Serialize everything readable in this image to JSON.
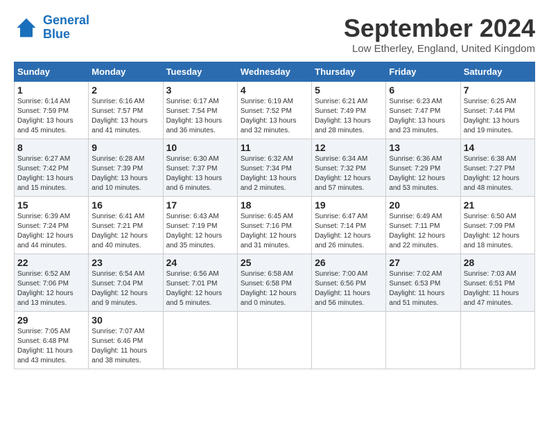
{
  "logo": {
    "line1": "General",
    "line2": "Blue"
  },
  "title": "September 2024",
  "subtitle": "Low Etherley, England, United Kingdom",
  "days_of_week": [
    "Sunday",
    "Monday",
    "Tuesday",
    "Wednesday",
    "Thursday",
    "Friday",
    "Saturday"
  ],
  "weeks": [
    [
      {
        "day": 1,
        "sunrise": "6:14 AM",
        "sunset": "7:59 PM",
        "daylight": "13 hours and 45 minutes"
      },
      {
        "day": 2,
        "sunrise": "6:16 AM",
        "sunset": "7:57 PM",
        "daylight": "13 hours and 41 minutes"
      },
      {
        "day": 3,
        "sunrise": "6:17 AM",
        "sunset": "7:54 PM",
        "daylight": "13 hours and 36 minutes"
      },
      {
        "day": 4,
        "sunrise": "6:19 AM",
        "sunset": "7:52 PM",
        "daylight": "13 hours and 32 minutes"
      },
      {
        "day": 5,
        "sunrise": "6:21 AM",
        "sunset": "7:49 PM",
        "daylight": "13 hours and 28 minutes"
      },
      {
        "day": 6,
        "sunrise": "6:23 AM",
        "sunset": "7:47 PM",
        "daylight": "13 hours and 23 minutes"
      },
      {
        "day": 7,
        "sunrise": "6:25 AM",
        "sunset": "7:44 PM",
        "daylight": "13 hours and 19 minutes"
      }
    ],
    [
      {
        "day": 8,
        "sunrise": "6:27 AM",
        "sunset": "7:42 PM",
        "daylight": "13 hours and 15 minutes"
      },
      {
        "day": 9,
        "sunrise": "6:28 AM",
        "sunset": "7:39 PM",
        "daylight": "13 hours and 10 minutes"
      },
      {
        "day": 10,
        "sunrise": "6:30 AM",
        "sunset": "7:37 PM",
        "daylight": "13 hours and 6 minutes"
      },
      {
        "day": 11,
        "sunrise": "6:32 AM",
        "sunset": "7:34 PM",
        "daylight": "13 hours and 2 minutes"
      },
      {
        "day": 12,
        "sunrise": "6:34 AM",
        "sunset": "7:32 PM",
        "daylight": "12 hours and 57 minutes"
      },
      {
        "day": 13,
        "sunrise": "6:36 AM",
        "sunset": "7:29 PM",
        "daylight": "12 hours and 53 minutes"
      },
      {
        "day": 14,
        "sunrise": "6:38 AM",
        "sunset": "7:27 PM",
        "daylight": "12 hours and 48 minutes"
      }
    ],
    [
      {
        "day": 15,
        "sunrise": "6:39 AM",
        "sunset": "7:24 PM",
        "daylight": "12 hours and 44 minutes"
      },
      {
        "day": 16,
        "sunrise": "6:41 AM",
        "sunset": "7:21 PM",
        "daylight": "12 hours and 40 minutes"
      },
      {
        "day": 17,
        "sunrise": "6:43 AM",
        "sunset": "7:19 PM",
        "daylight": "12 hours and 35 minutes"
      },
      {
        "day": 18,
        "sunrise": "6:45 AM",
        "sunset": "7:16 PM",
        "daylight": "12 hours and 31 minutes"
      },
      {
        "day": 19,
        "sunrise": "6:47 AM",
        "sunset": "7:14 PM",
        "daylight": "12 hours and 26 minutes"
      },
      {
        "day": 20,
        "sunrise": "6:49 AM",
        "sunset": "7:11 PM",
        "daylight": "12 hours and 22 minutes"
      },
      {
        "day": 21,
        "sunrise": "6:50 AM",
        "sunset": "7:09 PM",
        "daylight": "12 hours and 18 minutes"
      }
    ],
    [
      {
        "day": 22,
        "sunrise": "6:52 AM",
        "sunset": "7:06 PM",
        "daylight": "12 hours and 13 minutes"
      },
      {
        "day": 23,
        "sunrise": "6:54 AM",
        "sunset": "7:04 PM",
        "daylight": "12 hours and 9 minutes"
      },
      {
        "day": 24,
        "sunrise": "6:56 AM",
        "sunset": "7:01 PM",
        "daylight": "12 hours and 5 minutes"
      },
      {
        "day": 25,
        "sunrise": "6:58 AM",
        "sunset": "6:58 PM",
        "daylight": "12 hours and 0 minutes"
      },
      {
        "day": 26,
        "sunrise": "7:00 AM",
        "sunset": "6:56 PM",
        "daylight": "11 hours and 56 minutes"
      },
      {
        "day": 27,
        "sunrise": "7:02 AM",
        "sunset": "6:53 PM",
        "daylight": "11 hours and 51 minutes"
      },
      {
        "day": 28,
        "sunrise": "7:03 AM",
        "sunset": "6:51 PM",
        "daylight": "11 hours and 47 minutes"
      }
    ],
    [
      {
        "day": 29,
        "sunrise": "7:05 AM",
        "sunset": "6:48 PM",
        "daylight": "11 hours and 43 minutes"
      },
      {
        "day": 30,
        "sunrise": "7:07 AM",
        "sunset": "6:46 PM",
        "daylight": "11 hours and 38 minutes"
      },
      null,
      null,
      null,
      null,
      null
    ]
  ]
}
